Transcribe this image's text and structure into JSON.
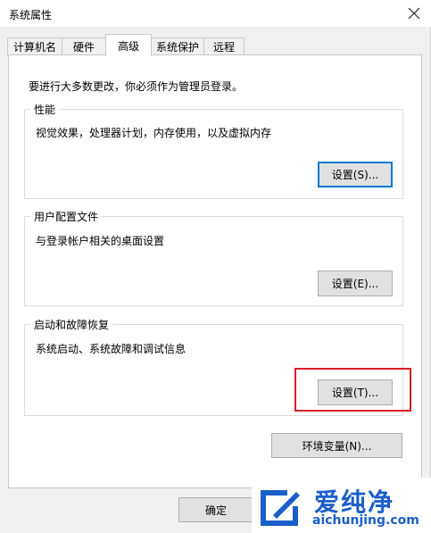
{
  "window": {
    "title": "系统属性"
  },
  "tabs": [
    {
      "label": "计算机名"
    },
    {
      "label": "硬件"
    },
    {
      "label": "高级"
    },
    {
      "label": "系统保护"
    },
    {
      "label": "远程"
    }
  ],
  "active_tab": "高级",
  "instruction": "要进行大多数更改，你必须作为管理员登录。",
  "groups": {
    "performance": {
      "title": "性能",
      "description": "视觉效果，处理器计划，内存使用，以及虚拟内存",
      "button": "设置(S)..."
    },
    "user_profiles": {
      "title": "用户配置文件",
      "description": "与登录帐户相关的桌面设置",
      "button": "设置(E)..."
    },
    "startup_recovery": {
      "title": "启动和故障恢复",
      "description": "系统启动、系统故障和调试信息",
      "button": "设置(T)..."
    }
  },
  "env_button": "环境变量(N)...",
  "footer": {
    "ok": "确定"
  },
  "watermark": {
    "name": "爱纯净",
    "url": "aichunjing.com"
  },
  "colors": {
    "highlight": "#d91e25",
    "focus": "#0078d7",
    "watermark": "#1b5ec9"
  }
}
